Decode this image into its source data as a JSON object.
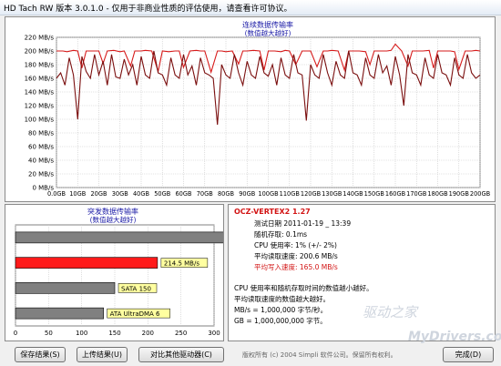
{
  "window": {
    "title": "HD Tach RW 版本 3.0.1.0 - 仅用于非商业性质的评估使用，请查看许可协议。"
  },
  "chart_data": [
    {
      "type": "line",
      "title": "连续数据传输率",
      "subtitle": "(数值越大越好)",
      "ylabel": "",
      "xlabel": "",
      "y_ticks": [
        "0 MB/s",
        "20 MB/s",
        "40 MB/s",
        "60 MB/s",
        "80 MB/s",
        "100 MB/s",
        "120 MB/s",
        "140 MB/s",
        "160 MB/s",
        "180 MB/s",
        "200 MB/s",
        "220 MB/s"
      ],
      "x_ticks": [
        "0.0GB",
        "10GB",
        "20GB",
        "30GB",
        "40GB",
        "50GB",
        "60GB",
        "70GB",
        "80GB",
        "90GB",
        "100GB",
        "110GB",
        "120GB",
        "130GB",
        "140GB",
        "150GB",
        "160GB",
        "170GB",
        "180GB",
        "190GB",
        "200GB"
      ],
      "xlim": [
        0,
        200
      ],
      "ylim": [
        0,
        220
      ],
      "grid": true,
      "series": [
        {
          "name": "",
          "color": "#d61a1a",
          "x": [
            0,
            3,
            5,
            8,
            10,
            12,
            14,
            17,
            20,
            22,
            24,
            27,
            30,
            32,
            35,
            37,
            40,
            42,
            45,
            48,
            50,
            53,
            56,
            58,
            60,
            63,
            66,
            68,
            70,
            73,
            76,
            78,
            80,
            83,
            86,
            88,
            90,
            93,
            96,
            98,
            100,
            103,
            106,
            108,
            110,
            113,
            116,
            118,
            120,
            123,
            126,
            128,
            130,
            133,
            136,
            138,
            140,
            143,
            146,
            148,
            150,
            153,
            156,
            158,
            160,
            163,
            166,
            168,
            170,
            173,
            176,
            178,
            180,
            183,
            186,
            188,
            190,
            193,
            196,
            198,
            200
          ],
          "y": [
            200,
            200,
            199,
            201,
            200,
            175,
            200,
            200,
            200,
            182,
            200,
            201,
            199,
            200,
            178,
            200,
            200,
            201,
            200,
            170,
            200,
            199,
            200,
            200,
            176,
            200,
            201,
            200,
            200,
            169,
            200,
            200,
            199,
            200,
            181,
            200,
            200,
            201,
            200,
            172,
            200,
            200,
            199,
            201,
            200,
            180,
            200,
            200,
            200,
            177,
            200,
            200,
            201,
            200,
            172,
            200,
            200,
            200,
            199,
            180,
            200,
            200,
            200,
            201,
            210,
            200,
            178,
            200,
            200,
            200,
            201,
            175,
            200,
            200,
            200,
            199,
            173,
            200,
            200,
            201,
            200
          ]
        },
        {
          "name": "",
          "color": "#7a0e0e",
          "x": [
            0,
            2,
            4,
            6,
            8,
            10,
            12,
            14,
            16,
            18,
            20,
            22,
            24,
            26,
            28,
            30,
            32,
            34,
            36,
            38,
            40,
            42,
            44,
            46,
            48,
            50,
            52,
            54,
            56,
            58,
            60,
            62,
            64,
            66,
            68,
            70,
            72,
            74,
            76,
            78,
            80,
            82,
            84,
            86,
            88,
            90,
            92,
            94,
            96,
            98,
            100,
            102,
            104,
            106,
            108,
            110,
            112,
            114,
            116,
            118,
            120,
            122,
            124,
            126,
            128,
            130,
            132,
            134,
            136,
            138,
            140,
            142,
            144,
            146,
            148,
            150,
            152,
            154,
            156,
            158,
            160,
            162,
            164,
            166,
            168,
            170,
            172,
            174,
            176,
            178,
            180,
            182,
            184,
            186,
            188,
            190,
            192,
            194,
            196,
            198,
            200
          ],
          "y": [
            160,
            168,
            150,
            190,
            165,
            100,
            192,
            170,
            160,
            195,
            165,
            185,
            150,
            195,
            162,
            160,
            188,
            165,
            180,
            150,
            192,
            165,
            160,
            200,
            168,
            165,
            150,
            190,
            165,
            160,
            195,
            165,
            178,
            150,
            190,
            168,
            165,
            160,
            92,
            180,
            165,
            160,
            195,
            168,
            150,
            185,
            165,
            160,
            192,
            168,
            163,
            180,
            150,
            190,
            165,
            160,
            195,
            168,
            165,
            98,
            180,
            165,
            160,
            195,
            168,
            150,
            185,
            165,
            160,
            200,
            168,
            165,
            150,
            190,
            165,
            160,
            195,
            168,
            178,
            150,
            192,
            165,
            120,
            195,
            168,
            165,
            150,
            190,
            165,
            160,
            195,
            168,
            165,
            150,
            190,
            165,
            160,
            195,
            168,
            160,
            165
          ]
        }
      ]
    },
    {
      "type": "bar",
      "orientation": "horizontal",
      "title": "突发数据传输率",
      "subtitle": "(数值越大越好)",
      "x_ticks": [
        "0",
        "50",
        "100",
        "150",
        "200",
        "250",
        "300"
      ],
      "xlim": [
        0,
        300
      ],
      "grid": true,
      "bars": [
        {
          "label": "SCSI Ultra320",
          "value": 320,
          "color": "#808080"
        },
        {
          "label": "214.5 MB/s",
          "value": 214.5,
          "color": "#ff1a1a"
        },
        {
          "label": "SATA 150",
          "value": 150,
          "color": "#808080"
        },
        {
          "label": "ATA UltraDMA 6",
          "value": 133,
          "color": "#808080"
        }
      ]
    }
  ],
  "info": {
    "drive_name": "OCZ-VERTEX2 1.27",
    "rows": [
      {
        "label": "测试日期 2011-01-19 _ 13:39",
        "red": false
      },
      {
        "label": "随机存取: 0.1ms",
        "red": false
      },
      {
        "label": "CPU 使用率: 1% (+/- 2%)",
        "red": false
      },
      {
        "label": "平均读取速度: 200.6 MB/s",
        "red": false
      },
      {
        "label": "平均写入速度: 165.0 MB/s",
        "red": true
      }
    ],
    "notes": [
      "CPU 使用率和随机存取时间的数值越小越好。",
      "平均读取速度的数值越大越好。",
      "MB/s = 1,000,000 字节/秒。",
      "GB = 1,000,000,000 字节。"
    ]
  },
  "buttons": {
    "save": "保存结果(S)",
    "upload": "上传结果(U)",
    "compare": "对比其他驱动器(C)",
    "done": "完成(D)"
  },
  "footer": {
    "copyright": "版权所有 (c) 2004 Simpli 软件公司。保留所有权利。"
  },
  "watermark": {
    "line1": "驱动之家",
    "line2": "MyDrivers.com"
  }
}
